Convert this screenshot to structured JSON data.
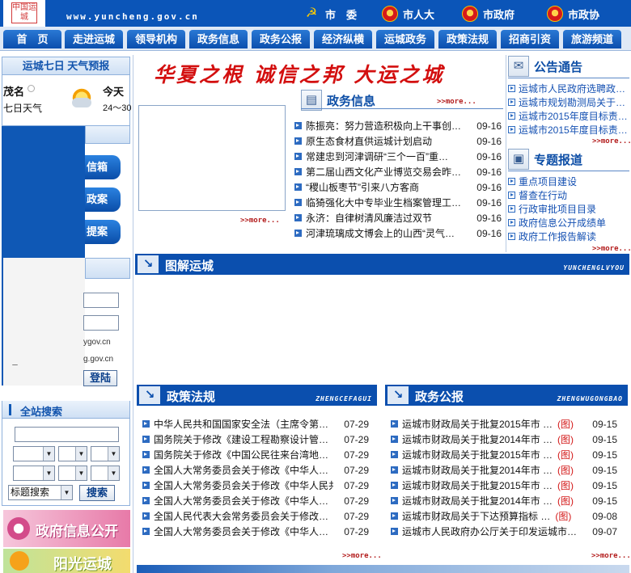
{
  "header": {
    "logo_text": "中国运城",
    "domain": "www.yuncheng.gov.cn",
    "links": [
      "市　委",
      "市人大",
      "市政府",
      "市政协"
    ]
  },
  "nav": [
    "首　页",
    "走进运城",
    "领导机构",
    "政务信息",
    "政务公报",
    "经济纵横",
    "运城政务",
    "政策法规",
    "招商引资",
    "旅游频道"
  ],
  "weather": {
    "title": "运城七日 天气预报",
    "city": "茂名",
    "seven_day": "七日天气",
    "today": "今天",
    "temp": "24～30"
  },
  "side_buttons": [
    "信箱",
    "政案",
    "提案"
  ],
  "login": {
    "domain1": "ygov.cn",
    "domain2": "g.gov.cn",
    "dash": "－",
    "button": "登陆"
  },
  "search": {
    "title": "全站搜索",
    "select_label": "标题搜索",
    "button": "搜索"
  },
  "banners": {
    "gov_info": "政府信息公开",
    "sunshine": "阳光运城"
  },
  "slogan": "华夏之根 诚信之邦 大运之城",
  "more": ">>more...",
  "news": {
    "title": "政务信息",
    "items": [
      {
        "text": "陈振亮：努力营造积极向上干事创…",
        "date": "09-16"
      },
      {
        "text": "原生态食材直供运城计划启动",
        "date": "09-16"
      },
      {
        "text": "常建忠到河津调研“三个一百”重…",
        "date": "09-16"
      },
      {
        "text": "第二届山西文化产业博览交易会昨…",
        "date": "09-16"
      },
      {
        "text": "“稷山板枣节”引来八方客商",
        "date": "09-16"
      },
      {
        "text": "临猗强化大中专毕业生档案管理工…",
        "date": "09-16"
      },
      {
        "text": "永济：自律树清风廉洁过双节",
        "date": "09-16"
      },
      {
        "text": "河津琉璃成文博会上的山西“灵气…",
        "date": "09-16"
      }
    ]
  },
  "notice": {
    "title": "公告通告",
    "items": [
      "运城市人民政府选聘政…",
      "运城市规划勘测局关于…",
      "运城市2015年度目标责…",
      "运城市2015年度目标责…"
    ]
  },
  "topics": {
    "title": "专题报道",
    "items": [
      "重点项目建设",
      "督查在行动",
      "行政审批项目目录",
      "政府信息公开成绩单",
      "政府工作报告解读"
    ]
  },
  "graphic": {
    "title": "图解运城",
    "pinyin": "YUNCHENGLVYOU"
  },
  "policy": {
    "title": "政策法规",
    "pinyin": "ZHENGCEFAGUI",
    "items": [
      {
        "text": "中华人民共和国国家安全法（主席令第…",
        "date": "07-29"
      },
      {
        "text": "国务院关于修改《建设工程勘察设计管…",
        "date": "07-29"
      },
      {
        "text": "国务院关于修改《中国公民往来台湾地…",
        "date": "07-29"
      },
      {
        "text": "全国人大常务委员会关于修改《中华人…",
        "date": "07-29"
      },
      {
        "text": "全国人大常务委员会关于修改《中华人民共…",
        "date": "07-29"
      },
      {
        "text": "全国人大常务委员会关于修改《中华人…",
        "date": "07-29"
      },
      {
        "text": "全国人民代表大会常务委员会关于修改…",
        "date": "07-29"
      },
      {
        "text": "全国人大常务委员会关于修改《中华人…",
        "date": "07-29"
      }
    ]
  },
  "bulletin": {
    "title": "政务公报",
    "pinyin": "ZHENGWUGONGBAO",
    "items": [
      {
        "text": "运城市财政局关于批复2015年市 …",
        "tag": "(图)",
        "date": "09-15"
      },
      {
        "text": "运城市财政局关于批复2014年市 …",
        "tag": "(图)",
        "date": "09-15"
      },
      {
        "text": "运城市财政局关于批复2015年市 …",
        "tag": "(图)",
        "date": "09-15"
      },
      {
        "text": "运城市财政局关于批复2014年市 …",
        "tag": "(图)",
        "date": "09-15"
      },
      {
        "text": "运城市财政局关于批复2015年市 …",
        "tag": "(图)",
        "date": "09-15"
      },
      {
        "text": "运城市财政局关于批复2014年市 …",
        "tag": "(图)",
        "date": "09-15"
      },
      {
        "text": "运城市财政局关于下达预算指标 …",
        "tag": "(图)",
        "date": "09-08"
      },
      {
        "text": "运城市人民政府办公厅关于印发运城市…",
        "tag": "",
        "date": "09-07"
      }
    ]
  },
  "colors": {
    "brand_blue": "#0b55b8",
    "slogan_red": "#d30f0f",
    "link_blue": "#1450b2"
  }
}
